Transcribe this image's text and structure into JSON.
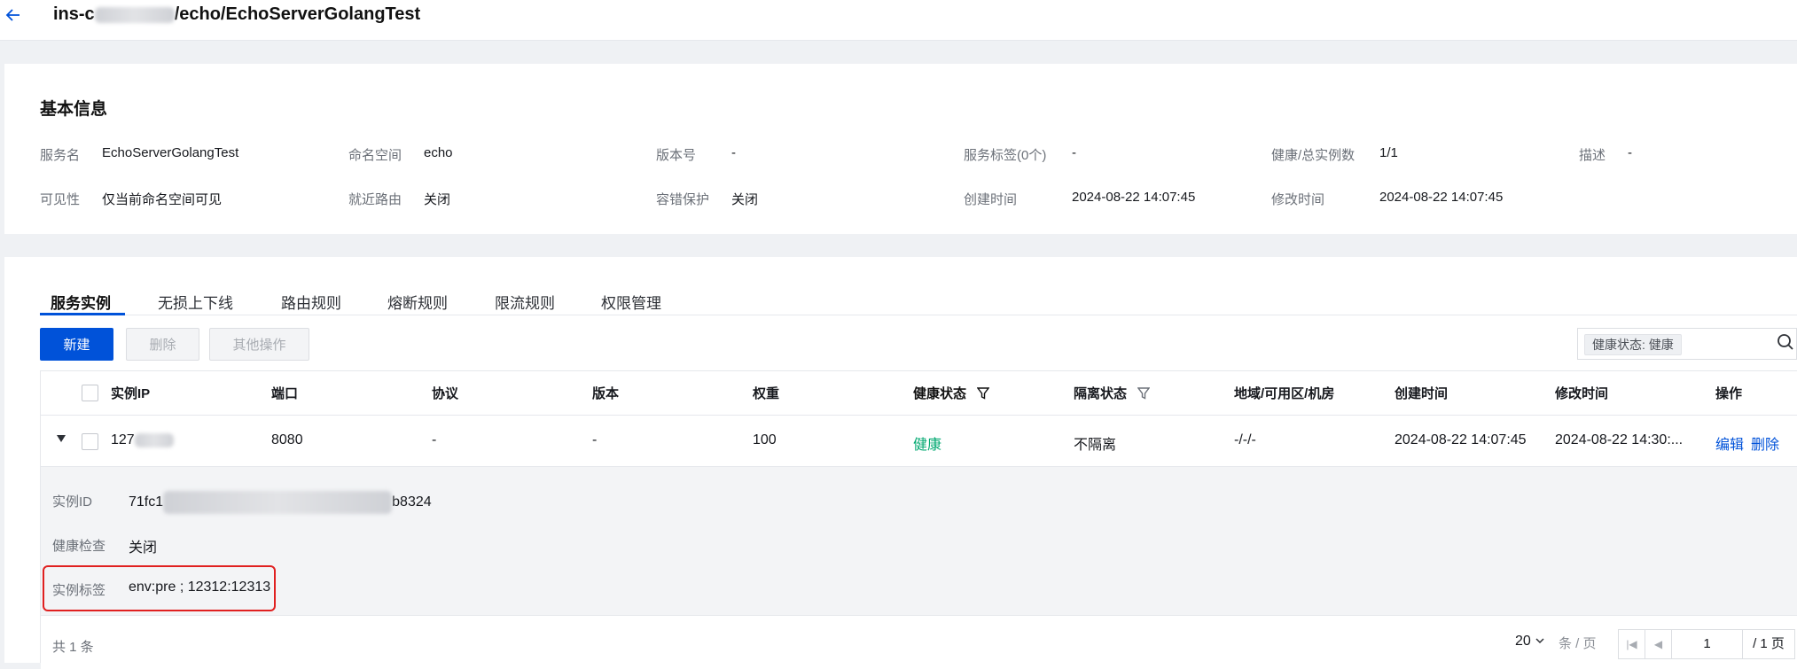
{
  "header": {
    "title_prefix": "ins-c",
    "title_suffix": "/echo/EchoServerGolangTest"
  },
  "basic_info": {
    "title": "基本信息",
    "items": [
      {
        "label": "服务名",
        "value": "EchoServerGolangTest"
      },
      {
        "label": "命名空间",
        "value": "echo"
      },
      {
        "label": "版本号",
        "value": "-"
      },
      {
        "label": "服务标签(0个)",
        "value": "-"
      },
      {
        "label": "健康/总实例数",
        "value": "1/1"
      },
      {
        "label": "描述",
        "value": "-"
      },
      {
        "label": "可见性",
        "value": "仅当前命名空间可见"
      },
      {
        "label": "就近路由",
        "value": "关闭"
      },
      {
        "label": "容错保护",
        "value": "关闭"
      },
      {
        "label": "创建时间",
        "value": "2024-08-22 14:07:45"
      },
      {
        "label": "修改时间",
        "value": "2024-08-22 14:07:45"
      }
    ]
  },
  "tabs": [
    "服务实例",
    "无损上下线",
    "路由规则",
    "熔断规则",
    "限流规则",
    "权限管理"
  ],
  "toolbar": {
    "new_label": "新建",
    "delete_label": "删除",
    "more_label": "其他操作",
    "search_tag": "健康状态: 健康"
  },
  "table": {
    "columns": [
      "实例IP",
      "端口",
      "协议",
      "版本",
      "权重",
      "健康状态",
      "隔离状态",
      "地域/可用区/机房",
      "创建时间",
      "修改时间",
      "操作"
    ],
    "row": {
      "ip": "127",
      "port": "8080",
      "protocol": "-",
      "version": "-",
      "weight": "100",
      "health": "健康",
      "isolation": "不隔离",
      "region": "-/-/-",
      "created": "2024-08-22 14:07:45",
      "modified": "2024-08-22 14:30:...",
      "edit": "编辑",
      "delete": "删除"
    },
    "detail": {
      "instance_id_label": "实例ID",
      "instance_id_prefix": "71fc1",
      "instance_id_suffix": "b8324",
      "health_check_label": "健康检查",
      "health_check_value": "关闭",
      "tags_label": "实例标签",
      "tags_value": "env:pre ; 12312:12313"
    }
  },
  "pagination": {
    "total": "共 1 条",
    "page_size": "20",
    "page_size_unit": "条 / 页",
    "current_page": "1",
    "total_pages": "/ 1 页"
  },
  "colors": {
    "primary": "#0052d9",
    "healthy": "#00a870",
    "highlight_border": "#e02020"
  }
}
